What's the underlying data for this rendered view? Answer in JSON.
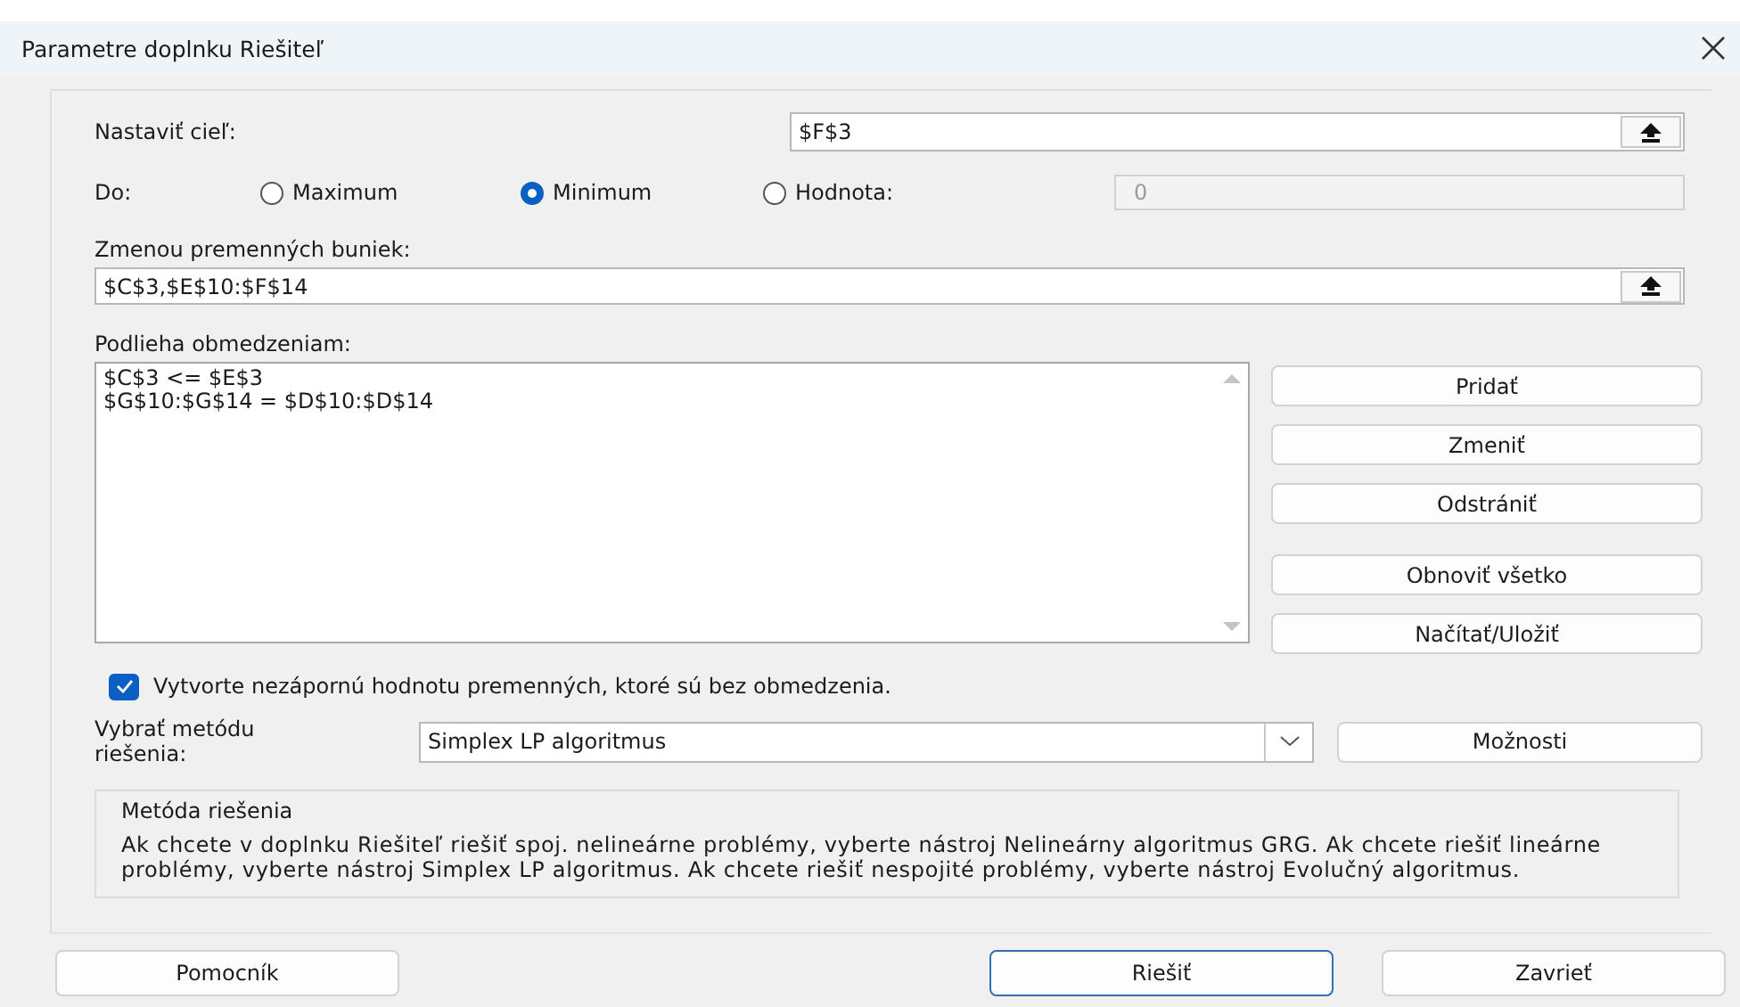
{
  "dialog": {
    "title": "Parametre doplnku Riešiteľ"
  },
  "objective": {
    "label": "Nastaviť cieľ:",
    "value": "$F$3"
  },
  "to": {
    "label": "Do:",
    "options": [
      {
        "label": "Maximum",
        "selected": false
      },
      {
        "label": "Minimum",
        "selected": true
      },
      {
        "label": "Hodnota:",
        "selected": false
      }
    ],
    "value_field": {
      "value": "0",
      "disabled": true
    }
  },
  "changing_cells": {
    "label": "Zmenou premenných buniek:",
    "value": "$C$3,$E$10:$F$14"
  },
  "constraints": {
    "label": "Podlieha obmedzeniam:",
    "items": [
      "$C$3 <= $E$3",
      "$G$10:$G$14 = $D$10:$D$14"
    ]
  },
  "constraint_buttons": [
    {
      "label": "Pridať"
    },
    {
      "label": "Zmeniť"
    },
    {
      "label": "Odstrániť"
    },
    {
      "label": "Obnoviť všetko"
    },
    {
      "label": "Načítať/Uložiť"
    }
  ],
  "nonnegative": {
    "label": "Vytvorte nezápornú hodnotu premenných, ktoré sú bez obmedzenia.",
    "checked": true
  },
  "method": {
    "label": "Vybrať metódu riešenia:",
    "value": "Simplex LP algoritmus",
    "options_button": "Možnosti"
  },
  "method_info": {
    "title": "Metóda riešenia",
    "text": "Ak chcete v doplnku Riešiteľ riešiť spoj. nelineárne problémy, vyberte nástroj Nelineárny algoritmus GRG. Ak chcete riešiť lineárne problémy, vyberte nástroj Simplex LP algoritmus. Ak chcete riešiť nespojité problémy, vyberte nástroj Evolučný algoritmus."
  },
  "buttons": [
    {
      "label": "Pomocník",
      "default": false
    },
    {
      "label": "Riešiť",
      "default": true
    },
    {
      "label": "Zavrieť",
      "default": false
    }
  ]
}
